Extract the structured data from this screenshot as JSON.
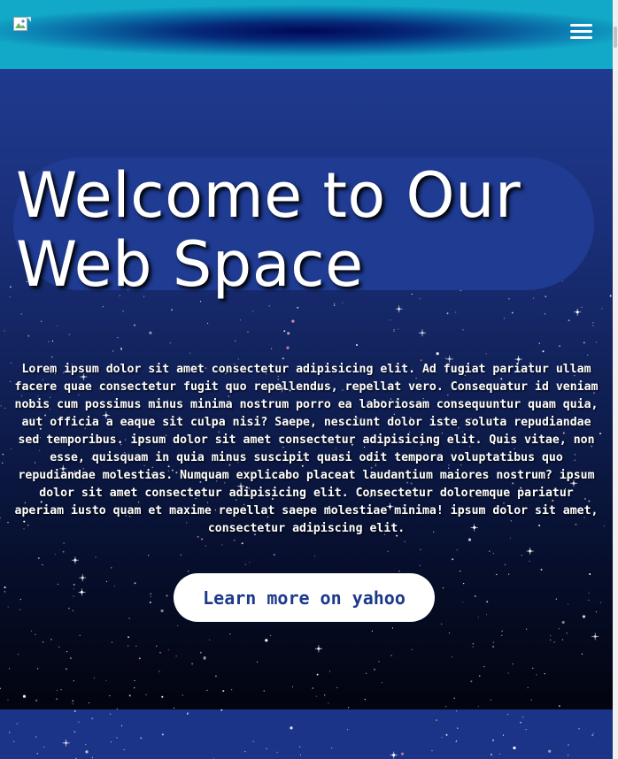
{
  "header": {
    "logo_icon": "broken-image-icon",
    "menu_icon": "hamburger-menu-icon"
  },
  "hero": {
    "title_line1": "Welcome to Our",
    "title_line2": "Web Space",
    "description": "Lorem ipsum dolor sit amet consectetur adipisicing elit. Ad fugiat pariatur ullam facere quae consectetur fugit quo repellendus, repellat vero. Consequatur id veniam nobis cum possimus minus minima nostrum porro ea laboriosam consequuntur quam quia, aut officia a eaque sit culpa nisi? Saepe, nesciunt dolor iste soluta repudiandae sed temporibus. ipsum dolor sit amet consectetur adipisicing elit. Quis vitae, non esse, quisquam in quia minus suscipit quasi odit tempora voluptatibus quo repudiandae molestias. Numquam explicabo placeat laudantium maiores nostrum? ipsum dolor sit amet consectetur adipisicing elit. Consectetur doloremque pariatur aperiam iusto quam et maxime repellat saepe molestiae minima! ipsum dolor sit amet, consectetur adipiscing elit.",
    "cta_label": "Learn more on yahoo"
  },
  "colors": {
    "header_gradient_center": "#000856",
    "header_gradient_edge": "#12a8c8",
    "hero_top": "#1f3a8e",
    "hero_bottom": "#02040e",
    "title_pill": "#1f3b92",
    "cta_text": "#1d3a8a",
    "cta_bg": "#ffffff"
  }
}
